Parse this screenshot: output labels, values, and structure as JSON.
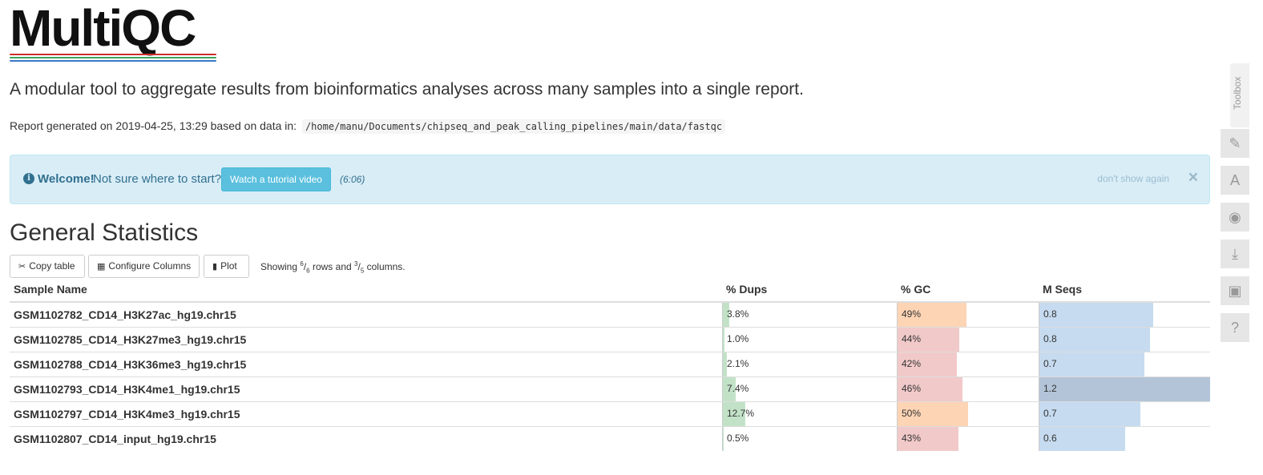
{
  "logo": {
    "text": "MultiQC",
    "line_colors": [
      "#cc2d2d",
      "#3ca35c",
      "#3978c4"
    ]
  },
  "lead": "A modular tool to aggregate results from bioinformatics analyses across many samples into a single report.",
  "report": {
    "prefix": "Report generated on 2019-04-25, 13:29 based on data in:",
    "path": "/home/manu/Documents/chipseq_and_peak_calling_pipelines/main/data/fastqc"
  },
  "welcome": {
    "title": "Welcome!",
    "text": "Not sure where to start?",
    "button": "Watch a tutorial video",
    "duration": "(6:06)",
    "dismiss": "don't show again",
    "close": "×",
    "icon": "info-icon"
  },
  "section_title": "General Statistics",
  "toolbar": {
    "copy": "Copy table",
    "configure": "Configure Columns",
    "plot": "Plot",
    "showing_prefix": "Showing",
    "rows_shown": "6",
    "rows_total": "6",
    "rows_word": "rows and",
    "cols_shown": "3",
    "cols_total": "5",
    "cols_word": "columns."
  },
  "table": {
    "headers": [
      "Sample Name",
      "% Dups",
      "% GC",
      "M Seqs"
    ],
    "rows": [
      {
        "sample": "GSM1102782_CD14_H3K27ac_hg19.chr15",
        "dups": "3.8%",
        "dups_value": 3.8,
        "gc": "49%",
        "gc_value": 49,
        "mseqs": "0.8",
        "mseqs_value": 0.8
      },
      {
        "sample": "GSM1102785_CD14_H3K27me3_hg19.chr15",
        "dups": "1.0%",
        "dups_value": 1.0,
        "gc": "44%",
        "gc_value": 44,
        "mseqs": "0.8",
        "mseqs_value": 0.78
      },
      {
        "sample": "GSM1102788_CD14_H3K36me3_hg19.chr15",
        "dups": "2.1%",
        "dups_value": 2.1,
        "gc": "42%",
        "gc_value": 42,
        "mseqs": "0.7",
        "mseqs_value": 0.74
      },
      {
        "sample": "GSM1102793_CD14_H3K4me1_hg19.chr15",
        "dups": "7.4%",
        "dups_value": 7.4,
        "gc": "46%",
        "gc_value": 46,
        "mseqs": "1.2",
        "mseqs_value": 1.2
      },
      {
        "sample": "GSM1102797_CD14_H3K4me3_hg19.chr15",
        "dups": "12.7%",
        "dups_value": 12.7,
        "gc": "50%",
        "gc_value": 50,
        "mseqs": "0.7",
        "mseqs_value": 0.71
      },
      {
        "sample": "GSM1102807_CD14_input_hg19.chr15",
        "dups": "0.5%",
        "dups_value": 0.5,
        "gc": "43%",
        "gc_value": 43,
        "mseqs": "0.6",
        "mseqs_value": 0.6
      }
    ],
    "scales": {
      "dups_max": 100,
      "gc_max": 100,
      "mseqs_max": 1.2
    },
    "colors": {
      "dups": [
        "#c2e2c8",
        "#a9d9b3"
      ],
      "gc": [
        "#f2c9c9",
        "#fdd4b4"
      ],
      "mseqs": [
        "#c6dbef",
        "#b3c4d8"
      ]
    }
  },
  "toolbox": {
    "label": "Toolbox",
    "buttons": [
      {
        "name": "pin-icon",
        "glyph": "✎"
      },
      {
        "name": "font-icon",
        "glyph": "A"
      },
      {
        "name": "hide-icon",
        "glyph": "◉"
      },
      {
        "name": "download-icon",
        "glyph": "⤓"
      },
      {
        "name": "save-icon",
        "glyph": "▣"
      },
      {
        "name": "help-icon",
        "glyph": "?"
      }
    ]
  }
}
